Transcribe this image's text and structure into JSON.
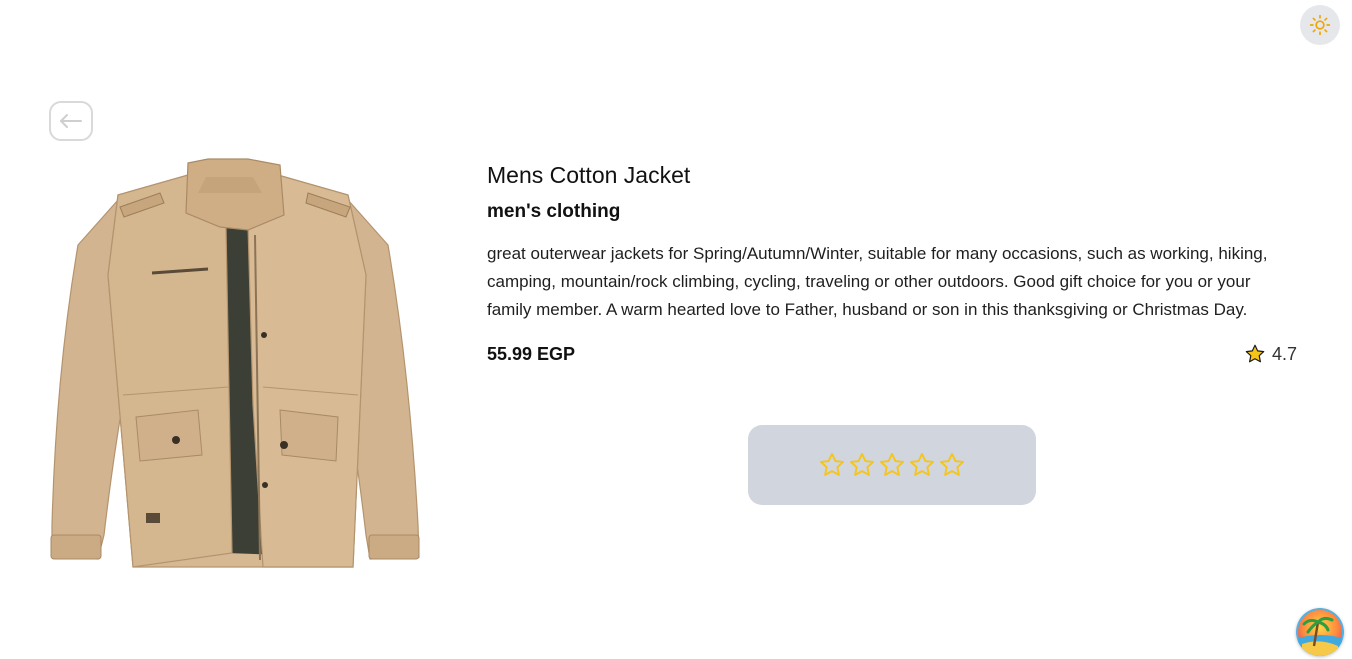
{
  "product": {
    "title": "Mens Cotton Jacket",
    "category": "men's clothing",
    "description": "great outerwear jackets for Spring/Autumn/Winter, suitable for many occasions, such as working, hiking, camping, mountain/rock climbing, cycling, traveling or other outdoors. Good gift choice for you or your family member. A warm hearted love to Father, husband or son in this thanksgiving or Christmas Day.",
    "price": "55.99 EGP",
    "rating": "4.7",
    "image_icon": "jacket-image"
  },
  "header": {
    "theme_icon": "sun-icon"
  },
  "nav": {
    "back_icon": "arrow-left-icon"
  },
  "rate_widget": {
    "star_count": 5,
    "selected": 0,
    "star_icon": "star-outline-icon"
  },
  "colors": {
    "star": "#f5c518",
    "rate_box_bg": "#d1d5de",
    "theme_sun": "#f0a500"
  },
  "floating_button": {
    "icon": "beach-icon"
  }
}
